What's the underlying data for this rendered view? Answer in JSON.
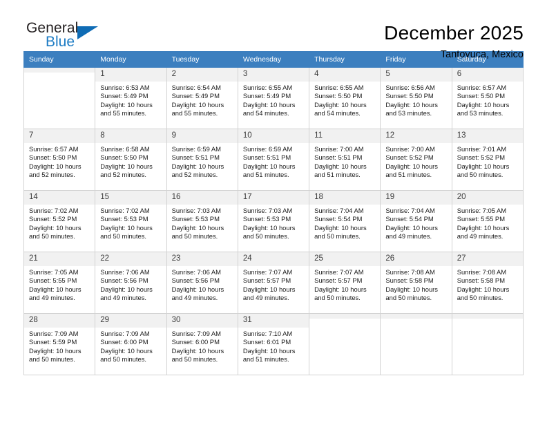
{
  "logo": {
    "word_top": "General",
    "word_bottom": "Blue",
    "triangle_color": "#0f6cb5",
    "text_color": "#231f20",
    "blue_color": "#1d7cc4"
  },
  "header": {
    "title": "December 2025",
    "subtitle": "Tantoyuca, Mexico"
  },
  "theme": {
    "header_row_bg": "#3c7fbf",
    "daynum_bg": "#f1f1f1",
    "grid_border": "#d2d2d2"
  },
  "calendar": {
    "weekdays": [
      "Sunday",
      "Monday",
      "Tuesday",
      "Wednesday",
      "Thursday",
      "Friday",
      "Saturday"
    ],
    "weeks": [
      [
        {
          "day": "",
          "empty": true
        },
        {
          "day": "1",
          "sunrise": "Sunrise: 6:53 AM",
          "sunset": "Sunset: 5:49 PM",
          "daylight1": "Daylight: 10 hours",
          "daylight2": "and 55 minutes."
        },
        {
          "day": "2",
          "sunrise": "Sunrise: 6:54 AM",
          "sunset": "Sunset: 5:49 PM",
          "daylight1": "Daylight: 10 hours",
          "daylight2": "and 55 minutes."
        },
        {
          "day": "3",
          "sunrise": "Sunrise: 6:55 AM",
          "sunset": "Sunset: 5:49 PM",
          "daylight1": "Daylight: 10 hours",
          "daylight2": "and 54 minutes."
        },
        {
          "day": "4",
          "sunrise": "Sunrise: 6:55 AM",
          "sunset": "Sunset: 5:50 PM",
          "daylight1": "Daylight: 10 hours",
          "daylight2": "and 54 minutes."
        },
        {
          "day": "5",
          "sunrise": "Sunrise: 6:56 AM",
          "sunset": "Sunset: 5:50 PM",
          "daylight1": "Daylight: 10 hours",
          "daylight2": "and 53 minutes."
        },
        {
          "day": "6",
          "sunrise": "Sunrise: 6:57 AM",
          "sunset": "Sunset: 5:50 PM",
          "daylight1": "Daylight: 10 hours",
          "daylight2": "and 53 minutes."
        }
      ],
      [
        {
          "day": "7",
          "sunrise": "Sunrise: 6:57 AM",
          "sunset": "Sunset: 5:50 PM",
          "daylight1": "Daylight: 10 hours",
          "daylight2": "and 52 minutes."
        },
        {
          "day": "8",
          "sunrise": "Sunrise: 6:58 AM",
          "sunset": "Sunset: 5:50 PM",
          "daylight1": "Daylight: 10 hours",
          "daylight2": "and 52 minutes."
        },
        {
          "day": "9",
          "sunrise": "Sunrise: 6:59 AM",
          "sunset": "Sunset: 5:51 PM",
          "daylight1": "Daylight: 10 hours",
          "daylight2": "and 52 minutes."
        },
        {
          "day": "10",
          "sunrise": "Sunrise: 6:59 AM",
          "sunset": "Sunset: 5:51 PM",
          "daylight1": "Daylight: 10 hours",
          "daylight2": "and 51 minutes."
        },
        {
          "day": "11",
          "sunrise": "Sunrise: 7:00 AM",
          "sunset": "Sunset: 5:51 PM",
          "daylight1": "Daylight: 10 hours",
          "daylight2": "and 51 minutes."
        },
        {
          "day": "12",
          "sunrise": "Sunrise: 7:00 AM",
          "sunset": "Sunset: 5:52 PM",
          "daylight1": "Daylight: 10 hours",
          "daylight2": "and 51 minutes."
        },
        {
          "day": "13",
          "sunrise": "Sunrise: 7:01 AM",
          "sunset": "Sunset: 5:52 PM",
          "daylight1": "Daylight: 10 hours",
          "daylight2": "and 50 minutes."
        }
      ],
      [
        {
          "day": "14",
          "sunrise": "Sunrise: 7:02 AM",
          "sunset": "Sunset: 5:52 PM",
          "daylight1": "Daylight: 10 hours",
          "daylight2": "and 50 minutes."
        },
        {
          "day": "15",
          "sunrise": "Sunrise: 7:02 AM",
          "sunset": "Sunset: 5:53 PM",
          "daylight1": "Daylight: 10 hours",
          "daylight2": "and 50 minutes."
        },
        {
          "day": "16",
          "sunrise": "Sunrise: 7:03 AM",
          "sunset": "Sunset: 5:53 PM",
          "daylight1": "Daylight: 10 hours",
          "daylight2": "and 50 minutes."
        },
        {
          "day": "17",
          "sunrise": "Sunrise: 7:03 AM",
          "sunset": "Sunset: 5:53 PM",
          "daylight1": "Daylight: 10 hours",
          "daylight2": "and 50 minutes."
        },
        {
          "day": "18",
          "sunrise": "Sunrise: 7:04 AM",
          "sunset": "Sunset: 5:54 PM",
          "daylight1": "Daylight: 10 hours",
          "daylight2": "and 50 minutes."
        },
        {
          "day": "19",
          "sunrise": "Sunrise: 7:04 AM",
          "sunset": "Sunset: 5:54 PM",
          "daylight1": "Daylight: 10 hours",
          "daylight2": "and 49 minutes."
        },
        {
          "day": "20",
          "sunrise": "Sunrise: 7:05 AM",
          "sunset": "Sunset: 5:55 PM",
          "daylight1": "Daylight: 10 hours",
          "daylight2": "and 49 minutes."
        }
      ],
      [
        {
          "day": "21",
          "sunrise": "Sunrise: 7:05 AM",
          "sunset": "Sunset: 5:55 PM",
          "daylight1": "Daylight: 10 hours",
          "daylight2": "and 49 minutes."
        },
        {
          "day": "22",
          "sunrise": "Sunrise: 7:06 AM",
          "sunset": "Sunset: 5:56 PM",
          "daylight1": "Daylight: 10 hours",
          "daylight2": "and 49 minutes."
        },
        {
          "day": "23",
          "sunrise": "Sunrise: 7:06 AM",
          "sunset": "Sunset: 5:56 PM",
          "daylight1": "Daylight: 10 hours",
          "daylight2": "and 49 minutes."
        },
        {
          "day": "24",
          "sunrise": "Sunrise: 7:07 AM",
          "sunset": "Sunset: 5:57 PM",
          "daylight1": "Daylight: 10 hours",
          "daylight2": "and 49 minutes."
        },
        {
          "day": "25",
          "sunrise": "Sunrise: 7:07 AM",
          "sunset": "Sunset: 5:57 PM",
          "daylight1": "Daylight: 10 hours",
          "daylight2": "and 50 minutes."
        },
        {
          "day": "26",
          "sunrise": "Sunrise: 7:08 AM",
          "sunset": "Sunset: 5:58 PM",
          "daylight1": "Daylight: 10 hours",
          "daylight2": "and 50 minutes."
        },
        {
          "day": "27",
          "sunrise": "Sunrise: 7:08 AM",
          "sunset": "Sunset: 5:58 PM",
          "daylight1": "Daylight: 10 hours",
          "daylight2": "and 50 minutes."
        }
      ],
      [
        {
          "day": "28",
          "sunrise": "Sunrise: 7:09 AM",
          "sunset": "Sunset: 5:59 PM",
          "daylight1": "Daylight: 10 hours",
          "daylight2": "and 50 minutes."
        },
        {
          "day": "29",
          "sunrise": "Sunrise: 7:09 AM",
          "sunset": "Sunset: 6:00 PM",
          "daylight1": "Daylight: 10 hours",
          "daylight2": "and 50 minutes."
        },
        {
          "day": "30",
          "sunrise": "Sunrise: 7:09 AM",
          "sunset": "Sunset: 6:00 PM",
          "daylight1": "Daylight: 10 hours",
          "daylight2": "and 50 minutes."
        },
        {
          "day": "31",
          "sunrise": "Sunrise: 7:10 AM",
          "sunset": "Sunset: 6:01 PM",
          "daylight1": "Daylight: 10 hours",
          "daylight2": "and 51 minutes."
        },
        {
          "day": "",
          "empty": true
        },
        {
          "day": "",
          "empty": true
        },
        {
          "day": "",
          "empty": true
        }
      ]
    ]
  }
}
